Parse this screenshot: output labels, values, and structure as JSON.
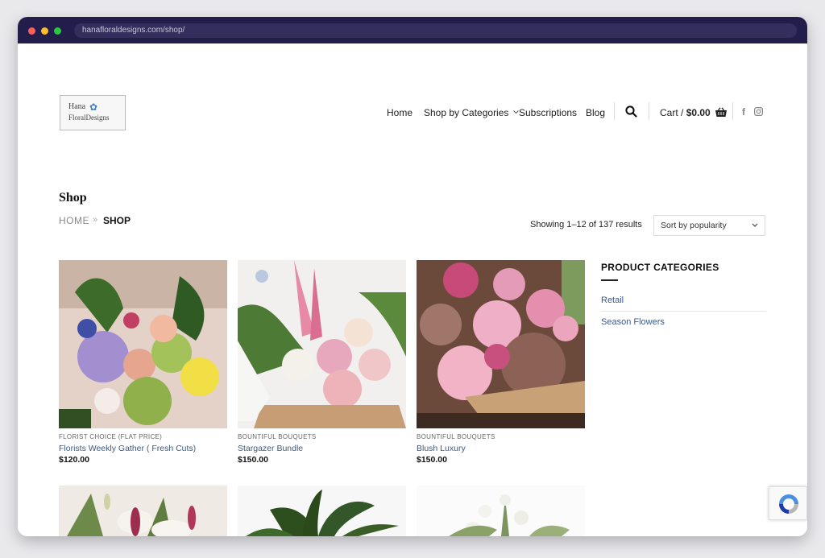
{
  "browser": {
    "url": "hanafloraldesigns.com/shop/"
  },
  "logo": {
    "line1": "Hana",
    "line2": "FloralDesigns"
  },
  "nav": {
    "home": "Home",
    "shop_by_categories": "Shop by Categories",
    "subscriptions": "Subscriptions",
    "blog": "Blog",
    "cart_label": "Cart /",
    "cart_total": "$0.00"
  },
  "page": {
    "title": "Shop",
    "breadcrumb_home": "HOME",
    "breadcrumb_sep": "»",
    "breadcrumb_current": "SHOP",
    "results_text": "Showing 1–12 of 137 results",
    "sort_selected": "Sort by popularity"
  },
  "products": [
    {
      "category": "FLORIST CHOICE (FLAT PRICE)",
      "name": "Florists Weekly Gather ( Fresh Cuts)",
      "price": "$120.00"
    },
    {
      "category": "BOUNTIFUL BOUQUETS",
      "name": "Stargazer Bundle",
      "price": "$150.00"
    },
    {
      "category": "BOUNTIFUL BOUQUETS",
      "name": "Blush Luxury",
      "price": "$150.00"
    }
  ],
  "sidebar": {
    "title": "PRODUCT CATEGORIES",
    "items": [
      {
        "label": "Retail"
      },
      {
        "label": "Season Flowers"
      }
    ]
  },
  "icons": {
    "search": "search-icon",
    "cart": "basket-icon",
    "facebook": "facebook-icon",
    "instagram": "instagram-icon",
    "chevron": "chevron-down-icon"
  },
  "colors": {
    "titlebar": "#221d4a",
    "link": "#3c5a8d"
  }
}
